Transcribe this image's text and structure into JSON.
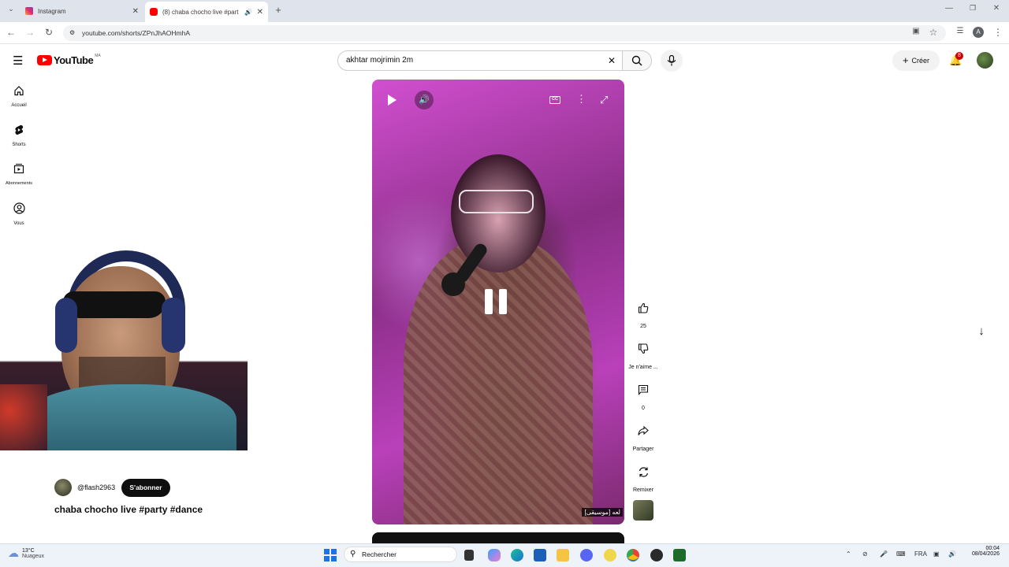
{
  "browser": {
    "tabs": [
      {
        "label": "Instagram",
        "active": false
      },
      {
        "label": "(8) chaba chocho live #part",
        "active": true
      }
    ],
    "url": "youtube.com/shorts/ZPnJhAOHmhA"
  },
  "youtube": {
    "logo_text": "YouTube",
    "country": "MA",
    "search_value": "akhtar mojrimin 2m",
    "create_label": "Créer",
    "notif_count": "8",
    "avatar_letter": "A",
    "sidebar": [
      {
        "label": "Accueil",
        "icon": "home-icon"
      },
      {
        "label": "Shorts",
        "icon": "shorts-icon"
      },
      {
        "label": "Abonnements",
        "icon": "subscriptions-icon"
      },
      {
        "label": "Vous",
        "icon": "account-icon"
      }
    ],
    "short": {
      "channel": "@flash2963",
      "subscribe_label": "S'abonner",
      "title": "chaba chocho live #party #dance",
      "overlay_caption": "لعه [موسيقى]"
    },
    "actions": {
      "like_count": "25",
      "dislike_label": "Je n'aime ...",
      "comment_count": "0",
      "share_label": "Partager",
      "remix_label": "Remixer"
    }
  },
  "taskbar": {
    "weather_temp": "13°C",
    "weather_desc": "Nuageux",
    "search_placeholder": "Rechercher",
    "lang": "FRA",
    "time": "00:04",
    "date": "08/04/2026"
  },
  "colors": {
    "youtube_red": "#ff0000",
    "subscribe_bg": "#0f0f0f",
    "video_magenta": "#c646c8"
  }
}
